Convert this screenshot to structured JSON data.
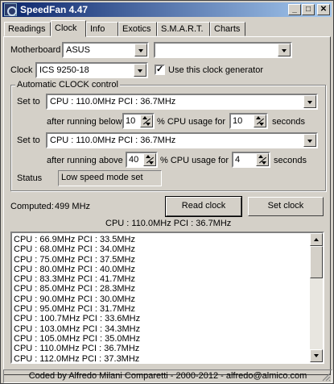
{
  "window": {
    "title": "SpeedFan 4.47",
    "controls": {
      "minimize": "_",
      "maximize": "□",
      "close": "✕"
    }
  },
  "tabs": [
    {
      "label": "Readings",
      "active": false
    },
    {
      "label": "Clock",
      "active": true
    },
    {
      "label": "Info",
      "active": false
    },
    {
      "label": "Exotics",
      "active": false
    },
    {
      "label": "S.M.A.R.T.",
      "active": false
    },
    {
      "label": "Charts",
      "active": false
    }
  ],
  "clock_tab": {
    "motherboard_label": "Motherboard",
    "motherboard_value": "ASUS",
    "motherboard_model_value": "",
    "clock_label": "Clock",
    "clock_value": "ICS 9250-18",
    "use_generator_checked": true,
    "use_generator_label": "Use this clock generator",
    "auto": {
      "group_title": "Automatic CLOCK control",
      "set_to_label_1": "Set to",
      "set_to_value_1": "CPU : 110.0MHz  PCI : 36.7MHz",
      "after_below_label": "after running below",
      "below_value": "10",
      "cpu_usage_label_1": "% CPU usage for",
      "seconds_value_1": "10",
      "seconds_label_1": "seconds",
      "set_to_label_2": "Set to",
      "set_to_value_2": "CPU : 110.0MHz  PCI : 36.7MHz",
      "after_above_label": "after running above",
      "above_value": "40",
      "cpu_usage_label_2": "% CPU usage for",
      "seconds_value_2": "4",
      "seconds_label_2": "seconds",
      "status_label": "Status",
      "status_value": "Low speed mode set"
    },
    "computed_label": "Computed:",
    "computed_value": "499 MHz",
    "read_clock_button": "Read clock",
    "set_clock_button": "Set clock",
    "current_clock": "CPU : 110.0MHz  PCI : 36.7MHz",
    "clock_list": [
      "CPU : 66.9MHz  PCI : 33.5MHz",
      "CPU : 68.0MHz  PCI : 34.0MHz",
      "CPU : 75.0MHz  PCI : 37.5MHz",
      "CPU : 80.0MHz  PCI : 40.0MHz",
      "CPU : 83.3MHz  PCI : 41.7MHz",
      "CPU : 85.0MHz  PCI : 28.3MHz",
      "CPU : 90.0MHz  PCI : 30.0MHz",
      "CPU : 95.0MHz  PCI : 31.7MHz",
      "CPU : 100.7MHz  PCI : 33.6MHz",
      "CPU : 103.0MHz  PCI : 34.3MHz",
      "CPU : 105.0MHz  PCI : 35.0MHz",
      "CPU : 110.0MHz  PCI : 36.7MHz",
      "CPU : 112.0MHz  PCI : 37.3MHz"
    ]
  },
  "statusbar": {
    "text": "Coded by Alfredo Milani Comparetti - 2000-2012 - alfredo@almico.com"
  }
}
